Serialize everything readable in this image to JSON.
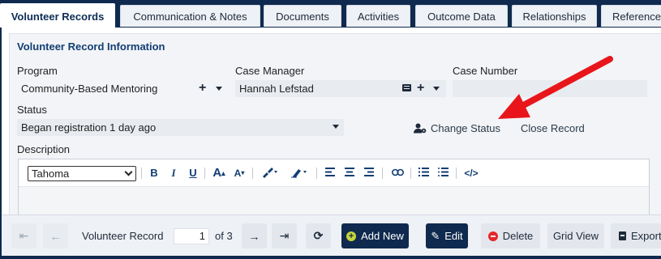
{
  "tabs": [
    {
      "label": "Volunteer Records",
      "active": true
    },
    {
      "label": "Communication & Notes",
      "active": false
    },
    {
      "label": "Documents",
      "active": false
    },
    {
      "label": "Activities",
      "active": false
    },
    {
      "label": "Outcome Data",
      "active": false
    },
    {
      "label": "Relationships",
      "active": false
    },
    {
      "label": "References",
      "active": false
    }
  ],
  "section": {
    "title": "Volunteer Record Information"
  },
  "fields": {
    "program": {
      "label": "Program",
      "value": "Community-Based Mentoring"
    },
    "case_manager": {
      "label": "Case Manager",
      "value": "Hannah Lefstad"
    },
    "case_number": {
      "label": "Case Number",
      "value": ""
    },
    "status": {
      "label": "Status",
      "value": "Began registration 1 day ago"
    },
    "description": {
      "label": "Description"
    }
  },
  "actions": {
    "change_status": "Change Status",
    "close_record": "Close Record"
  },
  "editor": {
    "font": "Tahoma",
    "toolbar": [
      "B",
      "I",
      "U"
    ]
  },
  "footer": {
    "record_label": "Volunteer Record",
    "page_value": "1",
    "page_of": "of 3",
    "add_new": "Add New",
    "edit": "Edit",
    "delete": "Delete",
    "grid_view": "Grid View",
    "export": "Export"
  },
  "colors": {
    "navy": "#0f2a4e",
    "accent_title": "#123e73",
    "arrow_red": "#e8161b",
    "add_icon_green": "#c6d43a",
    "delete_icon_red": "#e5262a"
  }
}
